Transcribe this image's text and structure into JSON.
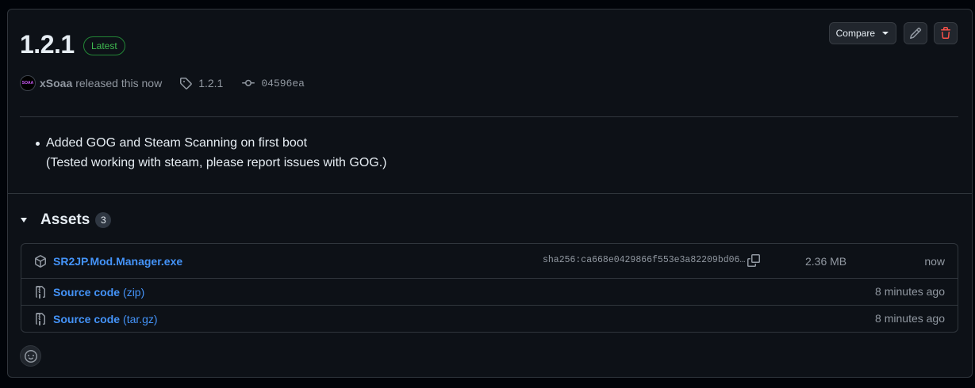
{
  "release": {
    "title": "1.2.1",
    "latest_badge": "Latest",
    "author": "xSoaa",
    "avatar_text": "SOAA",
    "released_text": "released this now",
    "tag": "1.2.1",
    "commit": "04596ea"
  },
  "actions": {
    "compare_label": "Compare"
  },
  "notes": [
    "Added GOG and Steam Scanning on first boot",
    "(Tested working with steam, please report issues with GOG.)"
  ],
  "assets": {
    "title": "Assets",
    "count": "3",
    "items": [
      {
        "name": "SR2JP.Mod.Manager.exe",
        "suffix": "",
        "sha": "sha256:ca668e0429866f553e3a82209bd06…",
        "size": "2.36 MB",
        "time": "now"
      },
      {
        "name": "Source code",
        "suffix": "(zip)",
        "time": "8 minutes ago"
      },
      {
        "name": "Source code",
        "suffix": "(tar.gz)",
        "time": "8 minutes ago"
      }
    ]
  },
  "colors": {
    "background": "#0d1117",
    "border": "#30363d",
    "link": "#4493f8",
    "latest": "#3fb950",
    "danger": "#f85149"
  }
}
